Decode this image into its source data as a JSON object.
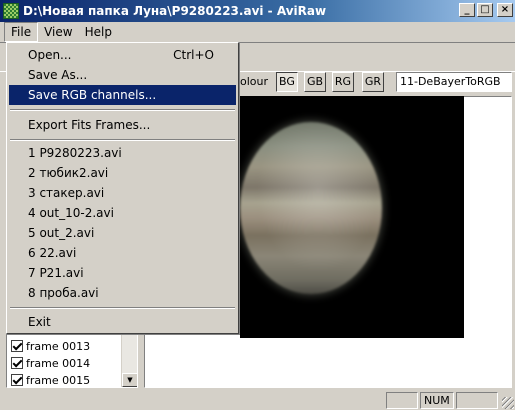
{
  "window": {
    "title": "D:\\Новая папка Луна\\P9280223.avi - AviRaw",
    "minimize_glyph": "_",
    "maximize_glyph": "□",
    "close_glyph": "×"
  },
  "menubar": {
    "items": [
      {
        "label": "File"
      },
      {
        "label": "View"
      },
      {
        "label": "Help"
      }
    ]
  },
  "file_menu": {
    "open": {
      "label": "Open...",
      "shortcut": "Ctrl+O"
    },
    "save_as": {
      "label": "Save As..."
    },
    "save_rgb": {
      "label": "Save RGB channels..."
    },
    "export_fits": {
      "label": "Export Fits Frames..."
    },
    "recent": [
      {
        "label": "1 P9280223.avi"
      },
      {
        "label": "2 тюбик2.avi"
      },
      {
        "label": "3 стакер.avi"
      },
      {
        "label": "4 out_10-2.avi"
      },
      {
        "label": "5 out_2.avi"
      },
      {
        "label": "6 22.avi"
      },
      {
        "label": "7 P21.avi"
      },
      {
        "label": "8 проба.avi"
      }
    ],
    "exit": {
      "label": "Exit"
    }
  },
  "toolbar": {
    "colour_label": "olour",
    "bayer_buttons": [
      {
        "label": "BG",
        "pressed": true
      },
      {
        "label": "GB",
        "pressed": false
      },
      {
        "label": "RG",
        "pressed": false
      },
      {
        "label": "GR",
        "pressed": false
      }
    ],
    "debayer_mode": "11-DeBayerToRGB"
  },
  "frames": [
    {
      "label": "frame 0013",
      "checked": true
    },
    {
      "label": "frame 0014",
      "checked": true
    },
    {
      "label": "frame 0015",
      "checked": true
    }
  ],
  "statusbar": {
    "num_indicator": "NUM"
  },
  "icons": {
    "app": "app-icon",
    "scroll_down": "scroll-down-arrow-icon",
    "checkbox": "checkbox-checked-icon",
    "resize_grip": "resize-grip-icon"
  },
  "colors": {
    "title_active": "#0a246a",
    "menu_highlight": "#0a246a",
    "face": "#d4d0c8"
  }
}
